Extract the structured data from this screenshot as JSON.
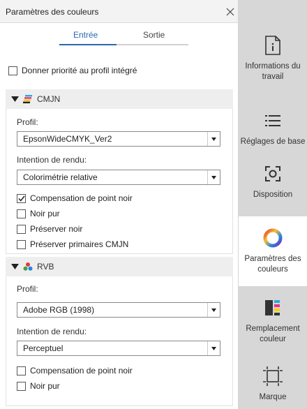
{
  "panel": {
    "title": "Paramètres des couleurs",
    "tabs": {
      "input": "Entrée",
      "output": "Sortie"
    },
    "priority_checkbox": {
      "label": "Donner priorité au profil intégré",
      "checked": false
    },
    "cmyk": {
      "title": "CMJN",
      "profile_label": "Profil:",
      "profile_value": "EpsonWideCMYK_Ver2",
      "intent_label": "Intention de rendu:",
      "intent_value": "Colorimétrie relative",
      "options": [
        {
          "label": "Compensation de point noir",
          "checked": true
        },
        {
          "label": "Noir pur",
          "checked": false
        },
        {
          "label": "Préserver noir",
          "checked": false
        },
        {
          "label": "Préserver primaires CMJN",
          "checked": false
        }
      ]
    },
    "rgb": {
      "title": "RVB",
      "profile_label": "Profil:",
      "profile_value": "Adobe RGB (1998)",
      "intent_label": "Intention de rendu:",
      "intent_value": "Perceptuel",
      "options": [
        {
          "label": "Compensation de point noir",
          "checked": false
        },
        {
          "label": "Noir pur",
          "checked": false
        }
      ]
    }
  },
  "sidebar": {
    "items": [
      {
        "label": "Informations du travail",
        "icon": "info-document-icon"
      },
      {
        "label": "Réglages de base",
        "icon": "list-icon"
      },
      {
        "label": "Disposition",
        "icon": "layout-icon"
      },
      {
        "label": "Paramètres des couleurs",
        "icon": "color-ring-icon",
        "active": true
      },
      {
        "label": "Remplacement couleur",
        "icon": "color-replace-icon"
      },
      {
        "label": "Marque",
        "icon": "crop-mark-icon"
      }
    ]
  },
  "colors": {
    "accent": "#2a67b3",
    "sidebar_bg": "#d7d7d7",
    "section_bg": "#eeeeee"
  }
}
